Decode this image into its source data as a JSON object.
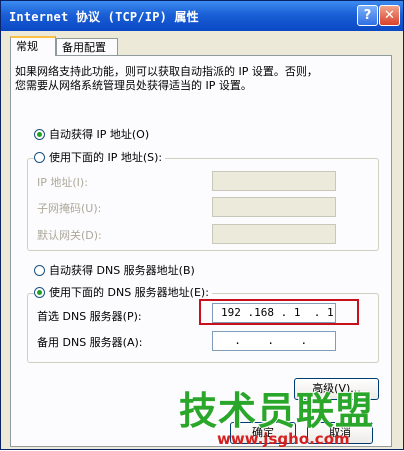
{
  "window": {
    "title": "Internet 协议 (TCP/IP) 属性",
    "help_glyph": "?",
    "close_glyph": "✕"
  },
  "tabs": [
    {
      "label": "常规",
      "active": true
    },
    {
      "label": "备用配置",
      "active": false
    }
  ],
  "description": "如果网络支持此功能，则可以获取自动指派的 IP 设置。否则，\n您需要从网络系统管理员处获得适当的 IP 设置。",
  "ip": {
    "auto_label": "自动获得 IP 地址(O)",
    "auto_selected": true,
    "manual_label": "使用下面的 IP 地址(S):",
    "manual_selected": false,
    "fields": [
      {
        "label": "IP 地址(I):",
        "value": ""
      },
      {
        "label": "子网掩码(U):",
        "value": ""
      },
      {
        "label": "默认网关(D):",
        "value": ""
      }
    ]
  },
  "dns": {
    "auto_label": "自动获得 DNS 服务器地址(B)",
    "auto_selected": false,
    "manual_label": "使用下面的 DNS 服务器地址(E):",
    "manual_selected": true,
    "preferred_label": "首选 DNS 服务器(P):",
    "preferred_value": "192 .168 . 1  . 1",
    "alternate_label": "备用 DNS 服务器(A):",
    "alternate_value": "  .    .    .  "
  },
  "buttons": {
    "advanced": "高级(V)...",
    "ok": "确定",
    "cancel": "取消"
  },
  "watermark": {
    "text": "技术员联盟",
    "url": "www.jsgho.com"
  },
  "colors": {
    "highlight": "#c8101a",
    "selected_radio": "#21a121",
    "titlebar": "#1a5fd6"
  }
}
